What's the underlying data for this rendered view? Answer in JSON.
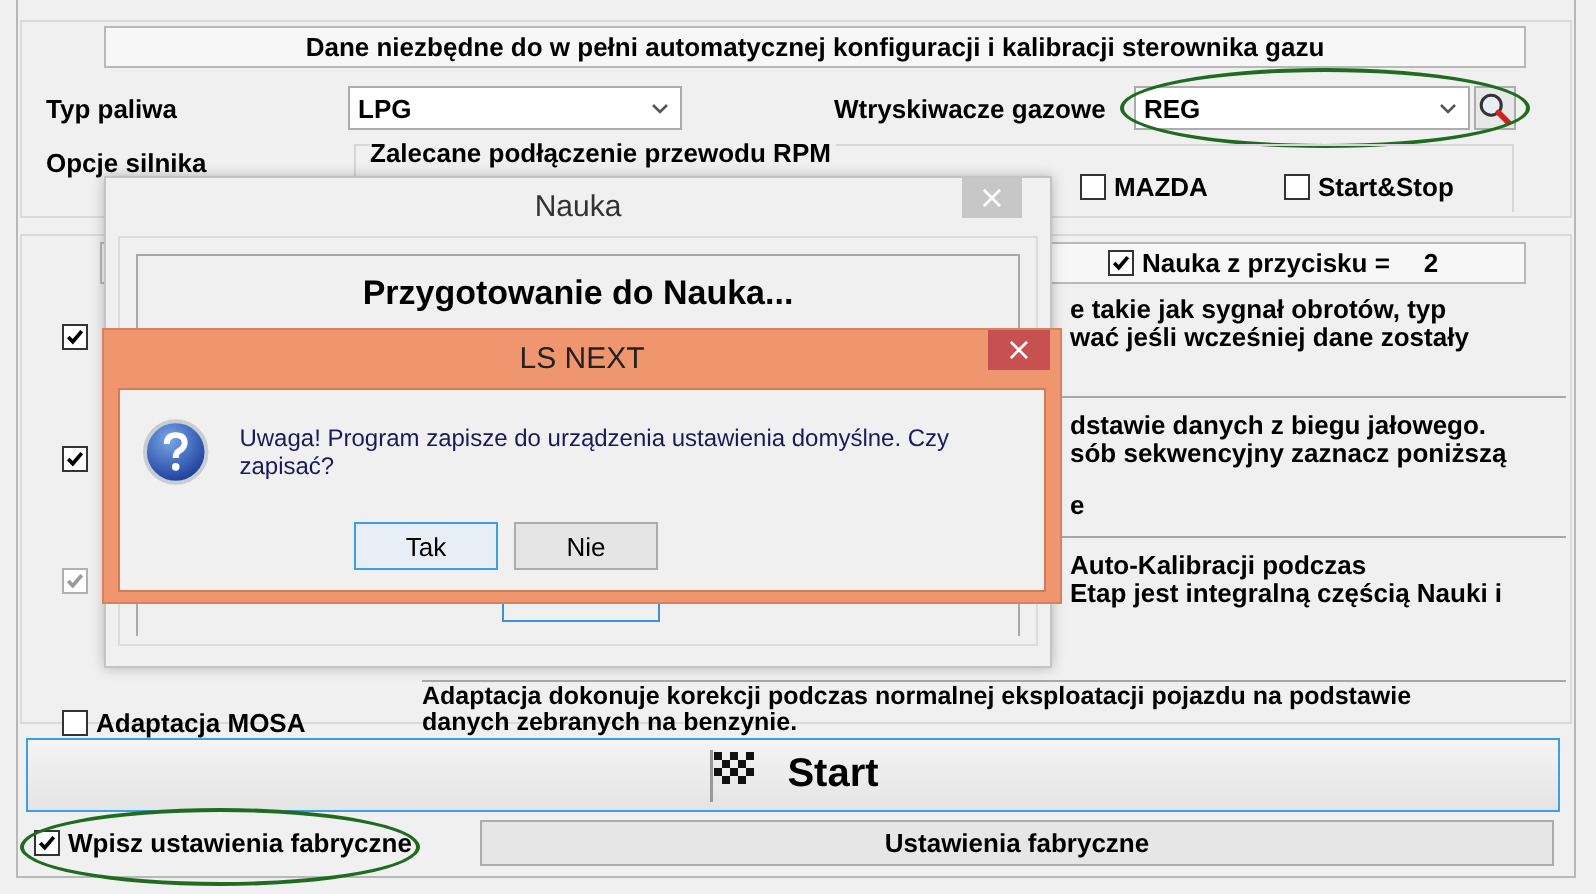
{
  "header": "Dane niezbędne do w pełni automatycznej konfiguracji i kalibracji sterownika gazu",
  "fuel": {
    "label": "Typ paliwa",
    "value": "LPG"
  },
  "injectors": {
    "label": "Wtryskiwacze gazowe",
    "value": "REG",
    "highlighted": true
  },
  "engine_options": {
    "label": "Opcje  silnika",
    "group_title": "Zalecane podłączenie przewodu RPM",
    "options": [
      {
        "label": "MAZDA",
        "checked": false
      },
      {
        "label": "Start&Stop",
        "checked": false
      }
    ]
  },
  "nauka_bar": {
    "label": "Nauka z przycisku =",
    "value": "2",
    "checked": true
  },
  "calibration_rows": [
    {
      "checked": true,
      "disabled": false,
      "description": [
        "e takie jak sygnał obrotów, typ",
        "wać jeśli wcześniej dane zostały"
      ]
    },
    {
      "checked": true,
      "disabled": false,
      "description": [
        "dstawie danych z biegu jałowego.",
        "sób sekwencyjny zaznacz poniższą",
        "e"
      ]
    },
    {
      "checked": true,
      "disabled": true,
      "description": [
        "Auto-Kalibracji podczas",
        "Etap jest integralną częścią Nauki i"
      ]
    },
    {
      "label": "Adaptacja MOSA",
      "checked": false,
      "disabled": false,
      "description": [
        "Adaptacja dokonuje korekcji podczas normalnej eksploatacji pojazdu na podstawie",
        "danych zebranych na benzynie."
      ]
    }
  ],
  "start_button": {
    "label": "Start"
  },
  "factory_checkbox": {
    "label": "Wpisz ustawienia fabryczne",
    "checked": true,
    "highlighted": true
  },
  "factory_button": {
    "label": "Ustawienia fabryczne"
  },
  "nauka_dialog": {
    "title": "Nauka",
    "close": "×",
    "heading": "Przygotowanie do Nauka..."
  },
  "message_dialog": {
    "title": "LS NEXT",
    "close": "×",
    "message": "Uwaga! Program zapisze do urządzenia ustawienia domyślne. Czy zapisać?",
    "buttons": [
      {
        "label": "Tak",
        "selected": true
      },
      {
        "label": "Nie",
        "selected": false
      }
    ]
  }
}
